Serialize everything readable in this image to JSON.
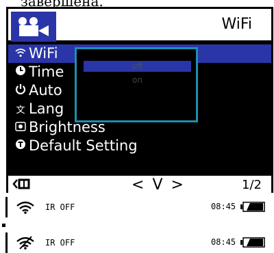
{
  "caption": "завершена.",
  "header": {
    "title": "WiFi",
    "icon": "camera-icon"
  },
  "menu": {
    "items": [
      {
        "label": "WiFi",
        "icon": "wifi-icon",
        "selected": true
      },
      {
        "label": "Time",
        "icon": "clock-icon"
      },
      {
        "label": "Auto",
        "icon": "power-icon"
      },
      {
        "label": "Lang",
        "icon": "language-icon"
      },
      {
        "label": "Brightness",
        "icon": "brightness-icon"
      },
      {
        "label": "Default Setting",
        "icon": "reset-icon"
      }
    ]
  },
  "popup": {
    "options": [
      "off",
      "on"
    ],
    "selected": "off"
  },
  "footer": {
    "back_icon": "back-icon",
    "nav_left": "<",
    "nav_down": "V",
    "nav_right": ">",
    "page": "1/2"
  },
  "status_bars": [
    {
      "wifi": "wifi-icon",
      "ir": "IR OFF",
      "time": "08:45",
      "battery": "battery-icon"
    },
    {
      "wifi": "wifi-off-icon",
      "ir": "IR OFF",
      "time": "08:45",
      "battery": "battery-icon"
    }
  ],
  "colors": {
    "selection": "#2a35a8",
    "popup_border": "#1e8fb0"
  }
}
